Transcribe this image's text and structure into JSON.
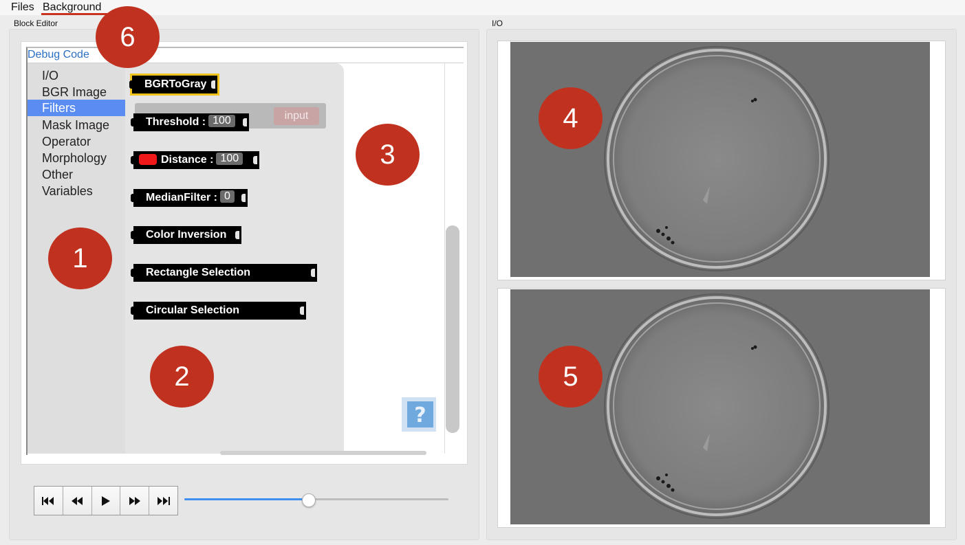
{
  "menu": {
    "items": [
      "Files",
      "Background"
    ]
  },
  "panels": {
    "block_editor_title": "Block Editor",
    "io_title": "I/O"
  },
  "editor": {
    "debug_label": "Debug Code",
    "categories": [
      "I/O",
      "BGR Image",
      "Filters",
      "Mask Image",
      "Operator",
      "Morphology",
      "Other",
      "Variables"
    ],
    "selected_category": "Filters",
    "blocks": [
      {
        "label": "BGRToGray"
      },
      {
        "label": "Threshold :",
        "field": "100"
      },
      {
        "label": "Distance :",
        "field": "100"
      },
      {
        "label": "MedianFilter :",
        "field": "0"
      },
      {
        "label": "Color Inversion"
      },
      {
        "label": "Rectangle Selection"
      },
      {
        "label": "Circular Selection"
      }
    ],
    "ghost_input": "input"
  },
  "transport": {
    "buttons": [
      "skip-to-start",
      "step-back",
      "play",
      "step-forward",
      "skip-to-end"
    ],
    "slider_fraction": 0.47
  },
  "badges": [
    "1",
    "2",
    "3",
    "4",
    "5",
    "6"
  ],
  "colors": {
    "badge": "#c0321f",
    "selection": "#5b8cf2",
    "slider_accent": "#3d8ff0",
    "block_highlight": "#f0c21c",
    "distance_color": "#f01818"
  }
}
